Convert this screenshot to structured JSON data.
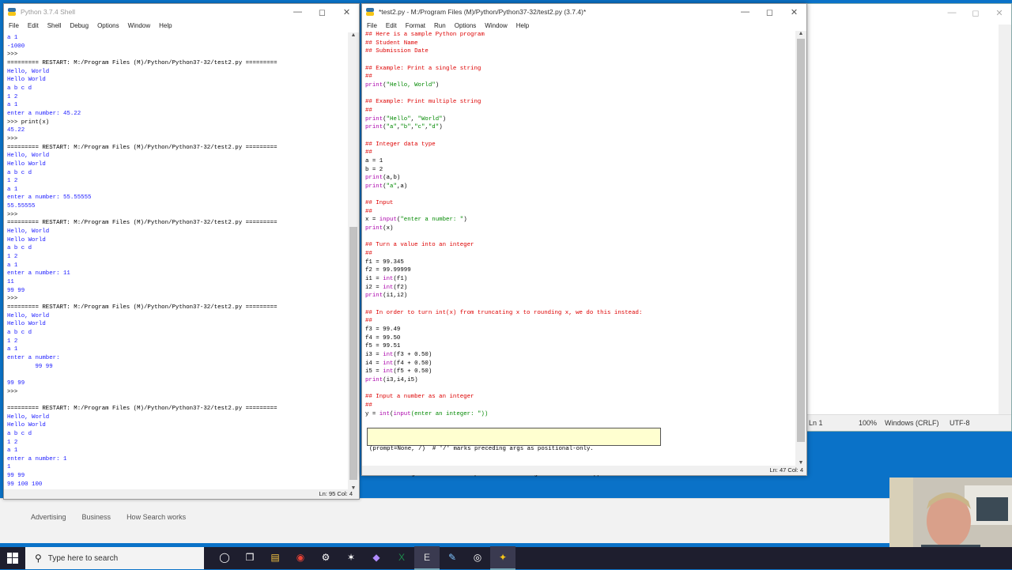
{
  "shell": {
    "title": "Python 3.7.4 Shell",
    "menu": [
      "File",
      "Edit",
      "Shell",
      "Debug",
      "Options",
      "Window",
      "Help"
    ],
    "lines": [
      {
        "t": "a 1",
        "c": "out"
      },
      {
        "t": "-1000",
        "c": "out"
      },
      {
        "t": ">>> ",
        "c": ""
      },
      {
        "t": "========= RESTART: M:/Program Files (M)/Python/Python37-32/test2.py =========",
        "c": ""
      },
      {
        "t": "Hello, World",
        "c": "out"
      },
      {
        "t": "Hello World",
        "c": "out"
      },
      {
        "t": "a b c d",
        "c": "out"
      },
      {
        "t": "1 2",
        "c": "out"
      },
      {
        "t": "a 1",
        "c": "out"
      },
      {
        "t": "enter a number: 45.22",
        "c": "out"
      },
      {
        "t": ">>> print(x)",
        "c": ""
      },
      {
        "t": "45.22",
        "c": "out"
      },
      {
        "t": ">>> ",
        "c": ""
      },
      {
        "t": "========= RESTART: M:/Program Files (M)/Python/Python37-32/test2.py =========",
        "c": ""
      },
      {
        "t": "Hello, World",
        "c": "out"
      },
      {
        "t": "Hello World",
        "c": "out"
      },
      {
        "t": "a b c d",
        "c": "out"
      },
      {
        "t": "1 2",
        "c": "out"
      },
      {
        "t": "a 1",
        "c": "out"
      },
      {
        "t": "enter a number: 55.55555",
        "c": "out"
      },
      {
        "t": "55.55555",
        "c": "out"
      },
      {
        "t": ">>> ",
        "c": ""
      },
      {
        "t": "========= RESTART: M:/Program Files (M)/Python/Python37-32/test2.py =========",
        "c": ""
      },
      {
        "t": "Hello, World",
        "c": "out"
      },
      {
        "t": "Hello World",
        "c": "out"
      },
      {
        "t": "a b c d",
        "c": "out"
      },
      {
        "t": "1 2",
        "c": "out"
      },
      {
        "t": "a 1",
        "c": "out"
      },
      {
        "t": "enter a number: 11",
        "c": "out"
      },
      {
        "t": "11",
        "c": "out"
      },
      {
        "t": "99 99",
        "c": "out"
      },
      {
        "t": ">>> ",
        "c": ""
      },
      {
        "t": "========= RESTART: M:/Program Files (M)/Python/Python37-32/test2.py =========",
        "c": ""
      },
      {
        "t": "Hello, World",
        "c": "out"
      },
      {
        "t": "Hello World",
        "c": "out"
      },
      {
        "t": "a b c d",
        "c": "out"
      },
      {
        "t": "1 2",
        "c": "out"
      },
      {
        "t": "a 1",
        "c": "out"
      },
      {
        "t": "enter a number:",
        "c": "out"
      },
      {
        "t": "        99 99",
        "c": "out"
      },
      {
        "t": "",
        "c": ""
      },
      {
        "t": "99 99",
        "c": "out"
      },
      {
        "t": ">>> ",
        "c": ""
      },
      {
        "t": "",
        "c": ""
      },
      {
        "t": "========= RESTART: M:/Program Files (M)/Python/Python37-32/test2.py =========",
        "c": ""
      },
      {
        "t": "Hello, World",
        "c": "out"
      },
      {
        "t": "Hello World",
        "c": "out"
      },
      {
        "t": "a b c d",
        "c": "out"
      },
      {
        "t": "1 2",
        "c": "out"
      },
      {
        "t": "a 1",
        "c": "out"
      },
      {
        "t": "enter a number: 1",
        "c": "out"
      },
      {
        "t": "1",
        "c": "out"
      },
      {
        "t": "99 99",
        "c": "out"
      },
      {
        "t": "99 100 100",
        "c": "out"
      },
      {
        "t": ">>> ",
        "c": ""
      }
    ],
    "status": "Ln: 95   Col: 4"
  },
  "editor": {
    "title": "*test2.py - M:/Program Files (M)/Python/Python37-32/test2.py (3.7.4)*",
    "menu": [
      "File",
      "Edit",
      "Format",
      "Run",
      "Options",
      "Window",
      "Help"
    ],
    "lines": [
      [
        {
          "t": "## Here is a sample Python program",
          "c": "com"
        }
      ],
      [
        {
          "t": "## Student Name",
          "c": "com"
        }
      ],
      [
        {
          "t": "## Submission Date",
          "c": "com"
        }
      ],
      [],
      [
        {
          "t": "## Example: Print a single string",
          "c": "com"
        }
      ],
      [
        {
          "t": "##",
          "c": "com"
        }
      ],
      [
        {
          "t": "print",
          "c": "kw"
        },
        {
          "t": "(",
          "c": ""
        },
        {
          "t": "\"Hello, World\"",
          "c": "str"
        },
        {
          "t": ")",
          "c": ""
        }
      ],
      [],
      [
        {
          "t": "## Example: Print multiple string",
          "c": "com"
        }
      ],
      [
        {
          "t": "##",
          "c": "com"
        }
      ],
      [
        {
          "t": "print",
          "c": "kw"
        },
        {
          "t": "(",
          "c": ""
        },
        {
          "t": "\"Hello\"",
          "c": "str"
        },
        {
          "t": ", ",
          "c": ""
        },
        {
          "t": "\"World\"",
          "c": "str"
        },
        {
          "t": ")",
          "c": ""
        }
      ],
      [
        {
          "t": "print",
          "c": "kw"
        },
        {
          "t": "(",
          "c": ""
        },
        {
          "t": "\"a\"",
          "c": "str"
        },
        {
          "t": ",",
          "c": ""
        },
        {
          "t": "\"b\"",
          "c": "str"
        },
        {
          "t": ",",
          "c": ""
        },
        {
          "t": "\"c\"",
          "c": "str"
        },
        {
          "t": ",",
          "c": ""
        },
        {
          "t": "\"d\"",
          "c": "str"
        },
        {
          "t": ")",
          "c": ""
        }
      ],
      [],
      [
        {
          "t": "## Integer data type",
          "c": "com"
        }
      ],
      [
        {
          "t": "##",
          "c": "com"
        }
      ],
      [
        {
          "t": "a = 1",
          "c": ""
        }
      ],
      [
        {
          "t": "b = 2",
          "c": ""
        }
      ],
      [
        {
          "t": "print",
          "c": "kw"
        },
        {
          "t": "(a,b)",
          "c": ""
        }
      ],
      [
        {
          "t": "print",
          "c": "kw"
        },
        {
          "t": "(",
          "c": ""
        },
        {
          "t": "\"a\"",
          "c": "str"
        },
        {
          "t": ",a)",
          "c": ""
        }
      ],
      [],
      [
        {
          "t": "## Input",
          "c": "com"
        }
      ],
      [
        {
          "t": "##",
          "c": "com"
        }
      ],
      [
        {
          "t": "x = ",
          "c": ""
        },
        {
          "t": "input",
          "c": "kw"
        },
        {
          "t": "(",
          "c": ""
        },
        {
          "t": "\"enter a number: \"",
          "c": "str"
        },
        {
          "t": ")",
          "c": ""
        }
      ],
      [
        {
          "t": "print",
          "c": "kw"
        },
        {
          "t": "(x)",
          "c": ""
        }
      ],
      [],
      [
        {
          "t": "## Turn a value into an integer",
          "c": "com"
        }
      ],
      [
        {
          "t": "##",
          "c": "com"
        }
      ],
      [
        {
          "t": "f1 = 99.345",
          "c": ""
        }
      ],
      [
        {
          "t": "f2 = 99.99999",
          "c": ""
        }
      ],
      [
        {
          "t": "i1 = ",
          "c": ""
        },
        {
          "t": "int",
          "c": "kw"
        },
        {
          "t": "(f1)",
          "c": ""
        }
      ],
      [
        {
          "t": "i2 = ",
          "c": ""
        },
        {
          "t": "int",
          "c": "kw"
        },
        {
          "t": "(f2)",
          "c": ""
        }
      ],
      [
        {
          "t": "print",
          "c": "kw"
        },
        {
          "t": "(i1,i2)",
          "c": ""
        }
      ],
      [],
      [
        {
          "t": "## In order to turn int(x) from truncating x to rounding x, we do this instead:",
          "c": "com"
        }
      ],
      [
        {
          "t": "##",
          "c": "com"
        }
      ],
      [
        {
          "t": "f3 = 99.49",
          "c": ""
        }
      ],
      [
        {
          "t": "f4 = 99.50",
          "c": ""
        }
      ],
      [
        {
          "t": "f5 = 99.51",
          "c": ""
        }
      ],
      [
        {
          "t": "i3 = ",
          "c": ""
        },
        {
          "t": "int",
          "c": "kw"
        },
        {
          "t": "(f3 + 0.50)",
          "c": ""
        }
      ],
      [
        {
          "t": "i4 = ",
          "c": ""
        },
        {
          "t": "int",
          "c": "kw"
        },
        {
          "t": "(f4 + 0.50)",
          "c": ""
        }
      ],
      [
        {
          "t": "i5 = ",
          "c": ""
        },
        {
          "t": "int",
          "c": "kw"
        },
        {
          "t": "(f5 + 0.50)",
          "c": ""
        }
      ],
      [
        {
          "t": "print",
          "c": "kw"
        },
        {
          "t": "(i3,i4,i5)",
          "c": ""
        }
      ],
      [],
      [
        {
          "t": "## Input a number as an integer",
          "c": "com"
        }
      ],
      [
        {
          "t": "##",
          "c": "com"
        }
      ],
      [
        {
          "t": "y = ",
          "c": ""
        },
        {
          "t": "int",
          "c": "kw"
        },
        {
          "t": "(",
          "c": ""
        },
        {
          "t": "input",
          "c": "kw"
        },
        {
          "t": "(enter an integer: \"))",
          "c": "str"
        }
      ]
    ],
    "calltip": [
      "(prompt=None, /)  # '/' marks preceding args as positional-only.",
      "Read a string from standard input.  The trailing newline is stripped."
    ],
    "status": "Ln: 47   Col: 4"
  },
  "bgwin": {
    "status_ln": "Ln 1",
    "zoom": "100%",
    "eol": "Windows (CRLF)",
    "encoding": "UTF-8"
  },
  "browser": {
    "links": [
      "Advertising",
      "Business",
      "How Search works"
    ]
  },
  "taskbar": {
    "search_placeholder": "Type here to search",
    "icons": [
      "cortana-icon",
      "task-view-icon",
      "file-explorer-icon",
      "chrome-icon",
      "steam-icon",
      "app-icon",
      "visual-studio-icon",
      "excel-icon",
      "epic-games-icon",
      "notepad-icon",
      "obs-icon",
      "python-icon"
    ]
  }
}
